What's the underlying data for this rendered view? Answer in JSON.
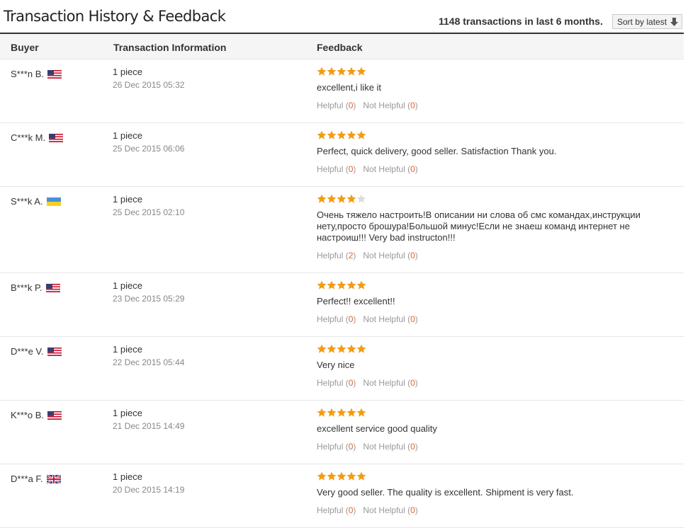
{
  "page": {
    "title": "Transaction History & Feedback",
    "summary": "1148 transactions in last 6 months.",
    "sort_label": "Sort by latest",
    "sort_icon": "arrow-down-icon"
  },
  "columns": {
    "buyer": "Buyer",
    "transaction": "Transaction Information",
    "feedback": "Feedback"
  },
  "labels": {
    "helpful": "Helpful",
    "not_helpful": "Not Helpful"
  },
  "colors": {
    "star_on": "#f39c12",
    "star_off": "#dddddd",
    "count": "#e4622d"
  },
  "rows": [
    {
      "buyer": "S***n B.",
      "flag": "us-flag-icon",
      "qty": "1 piece",
      "date": "26 Dec 2015 05:32",
      "stars": 5,
      "comment": "excellent,i like it",
      "helpful": "0",
      "not_helpful": "0"
    },
    {
      "buyer": "C***k M.",
      "flag": "us-flag-icon",
      "qty": "1 piece",
      "date": "25 Dec 2015 06:06",
      "stars": 5,
      "comment": "Perfect, quick delivery, good seller. Satisfaction Thank you.",
      "helpful": "0",
      "not_helpful": "0"
    },
    {
      "buyer": "S***k A.",
      "flag": "ua-flag-icon",
      "qty": "1 piece",
      "date": "25 Dec 2015 02:10",
      "stars": 4,
      "comment": "Очень тяжело настроить!В описании ни слова об смс командах,инструкции нету,просто брошура!Большой минус!Если не знаеш команд интернет не настроиш!!! Very bad instructon!!!",
      "helpful": "2",
      "not_helpful": "0"
    },
    {
      "buyer": "B***k P.",
      "flag": "us-flag-icon",
      "qty": "1 piece",
      "date": "23 Dec 2015 05:29",
      "stars": 5,
      "comment": "Perfect!! excellent!!",
      "helpful": "0",
      "not_helpful": "0"
    },
    {
      "buyer": "D***e V.",
      "flag": "us-flag-icon",
      "qty": "1 piece",
      "date": "22 Dec 2015 05:44",
      "stars": 5,
      "comment": "Very nice",
      "helpful": "0",
      "not_helpful": "0"
    },
    {
      "buyer": "K***o B.",
      "flag": "us-flag-icon",
      "qty": "1 piece",
      "date": "21 Dec 2015 14:49",
      "stars": 5,
      "comment": "excellent service good quality",
      "helpful": "0",
      "not_helpful": "0"
    },
    {
      "buyer": "D***a F.",
      "flag": "uk-flag-icon",
      "qty": "1 piece",
      "date": "20 Dec 2015 14:19",
      "stars": 5,
      "comment": "Very good seller. The quality is excellent. Shipment is very fast.",
      "helpful": "0",
      "not_helpful": "0"
    }
  ]
}
